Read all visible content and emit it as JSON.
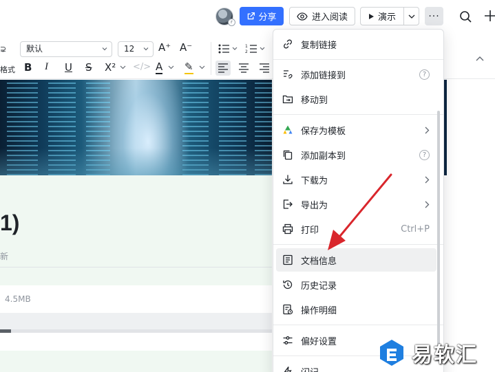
{
  "header": {
    "share_label": "分享",
    "read_label": "进入阅读",
    "present_label": "演示",
    "more_label": "···",
    "avatar_badge": "r"
  },
  "toolbar": {
    "left_top_label": "⊋",
    "left_bottom_label": "格式",
    "font_value": "默认",
    "size_value": "12",
    "increase_font": "A⁺",
    "decrease_font": "A⁻",
    "bold": "B",
    "italic": "I",
    "underline": "U",
    "strike": "S",
    "superscript": "X²",
    "code": "</>",
    "font_color": "A",
    "highlight": "✎"
  },
  "document": {
    "title_fragment": "1)",
    "subtitle_fragment": "新",
    "file_size": "4.5MB",
    "progress_fraction": 0.04
  },
  "menu": {
    "items": [
      {
        "label": "复制链接",
        "icon": "link-icon"
      },
      {
        "label": "添加链接到",
        "icon": "link-add-icon",
        "help": "?"
      },
      {
        "label": "移动到",
        "icon": "folder-move-icon"
      },
      {
        "label": "保存为模板",
        "icon": "template-icon"
      },
      {
        "label": "添加副本到",
        "icon": "copy-icon",
        "help": "?"
      },
      {
        "label": "下载为",
        "icon": "download-icon"
      },
      {
        "label": "导出为",
        "icon": "export-icon"
      },
      {
        "label": "打印",
        "icon": "print-icon",
        "shortcut": "Ctrl+P"
      },
      {
        "label": "文档信息",
        "icon": "doc-info-icon"
      },
      {
        "label": "历史记录",
        "icon": "history-icon"
      },
      {
        "label": "操作明细",
        "icon": "operation-log-icon"
      },
      {
        "label": "偏好设置",
        "icon": "preferences-icon"
      },
      {
        "label": "闪记",
        "icon": "flash-note-icon"
      }
    ]
  },
  "watermark": {
    "text": "易软汇"
  },
  "colors": {
    "accent": "#3370ff",
    "arrow": "#d9262c",
    "menu_highlight": "#eff0f1"
  }
}
